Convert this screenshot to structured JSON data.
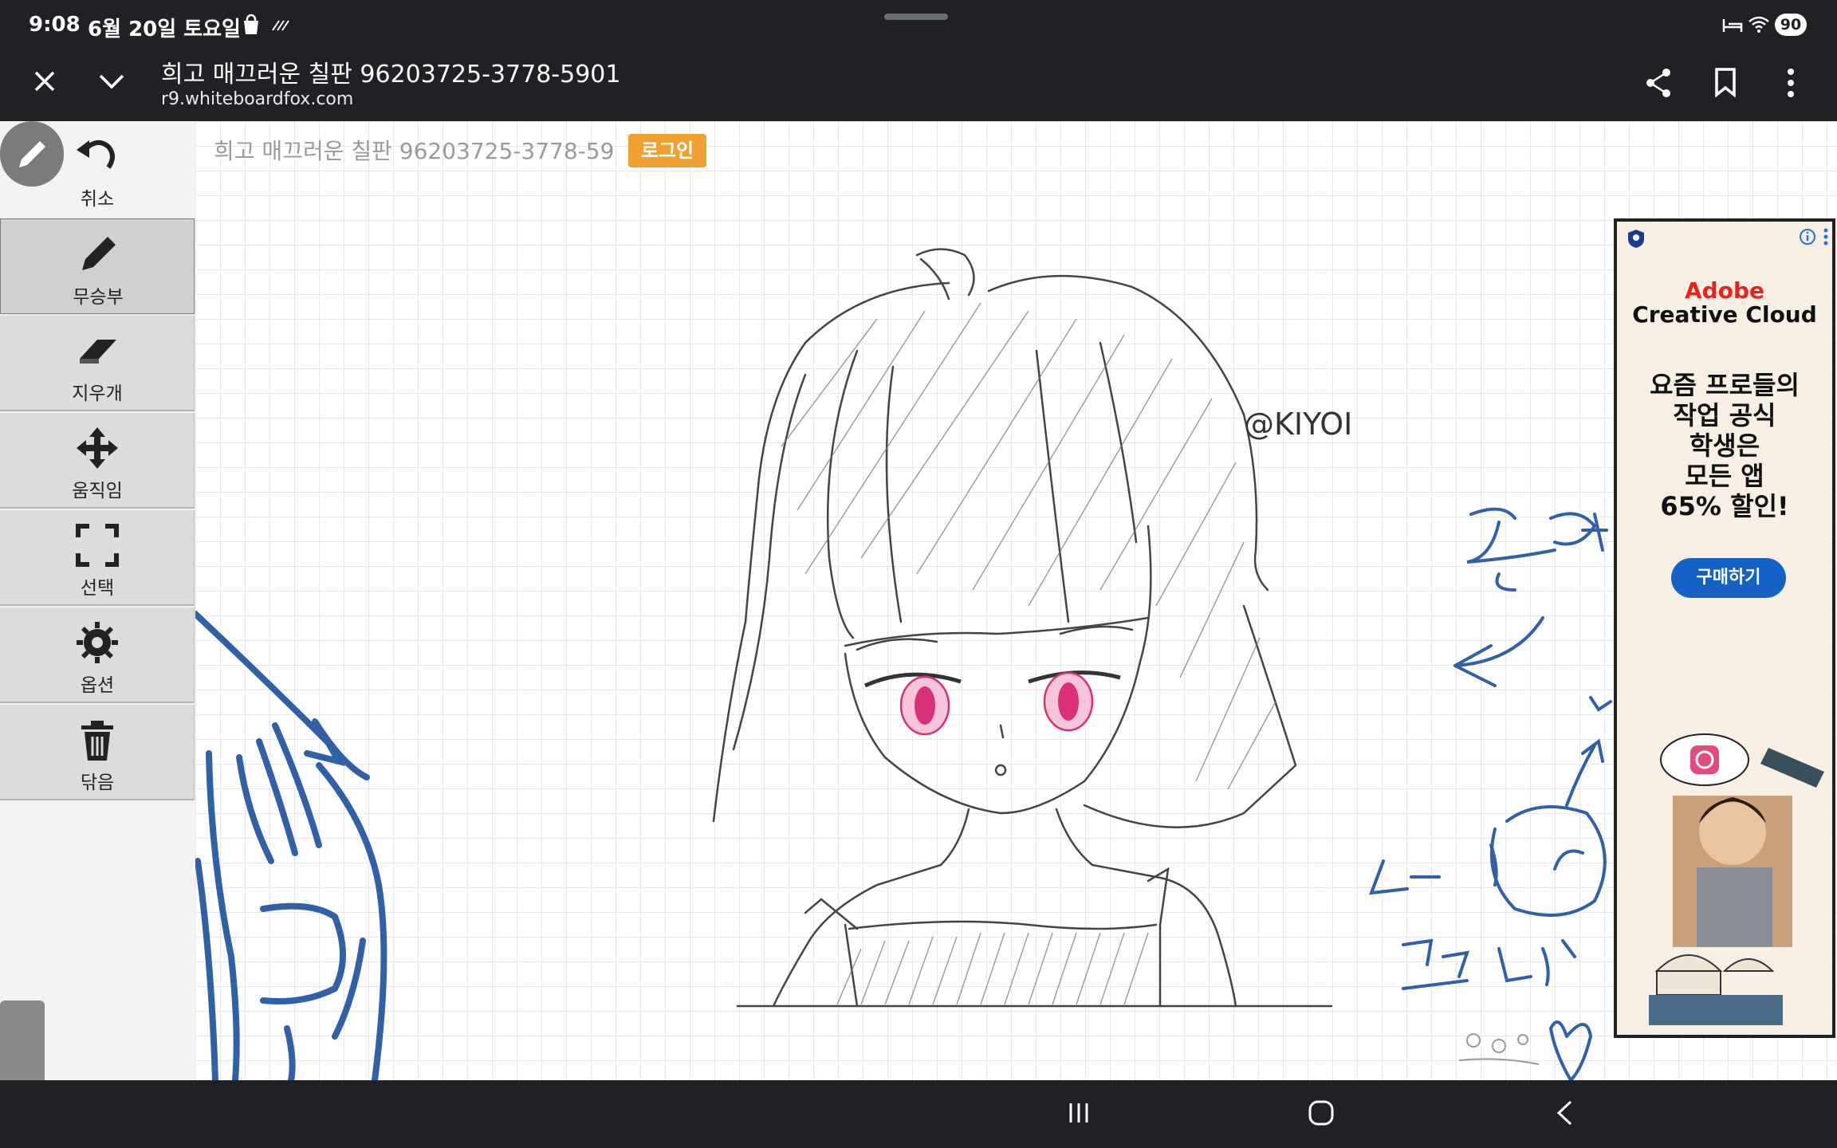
{
  "status_bar": {
    "time": "9:08",
    "date": "6월 20일 토요일",
    "battery": "90"
  },
  "browser": {
    "page_title": "희고 매끄러운 칠판 96203725-3778-5901",
    "host": "r9.whiteboardfox.com",
    "close_icon": "close-icon",
    "expand_icon": "chevron-down-icon",
    "share_icon": "share-icon",
    "bookmark_icon": "bookmark-icon",
    "menu_icon": "more-vert-icon"
  },
  "board": {
    "name": "희고 매끄러운 칠판 96203725-3778-59",
    "login_label": "로그인"
  },
  "toolbar": {
    "items": [
      {
        "label": "취소",
        "icon": "undo-icon"
      },
      {
        "label": "무승부",
        "icon": "pen-icon"
      },
      {
        "label": "지우개",
        "icon": "eraser-icon"
      },
      {
        "label": "움직임",
        "icon": "move-icon"
      },
      {
        "label": "선택",
        "icon": "select-icon"
      },
      {
        "label": "옵션",
        "icon": "gear-icon"
      },
      {
        "label": "닦음",
        "icon": "trash-icon"
      }
    ]
  },
  "drawing": {
    "signature": "@KIYOI"
  },
  "ad": {
    "brand_line1": "Adobe",
    "brand_line2": "Creative Cloud",
    "copy_line1": "요즘 프로들의",
    "copy_line2": "작업 공식",
    "copy_line3": "학생은",
    "copy_line4": "모든 앱",
    "copy_line5": "65% 할인!",
    "cta": "구매하기"
  },
  "colors": {
    "chrome_dark": "#202124",
    "login_orange": "#f0a030",
    "ink_blue": "#3060a8",
    "eye_pink": "#d8307a",
    "adobe_red": "#e8231a",
    "cta_blue": "#1463c4"
  }
}
